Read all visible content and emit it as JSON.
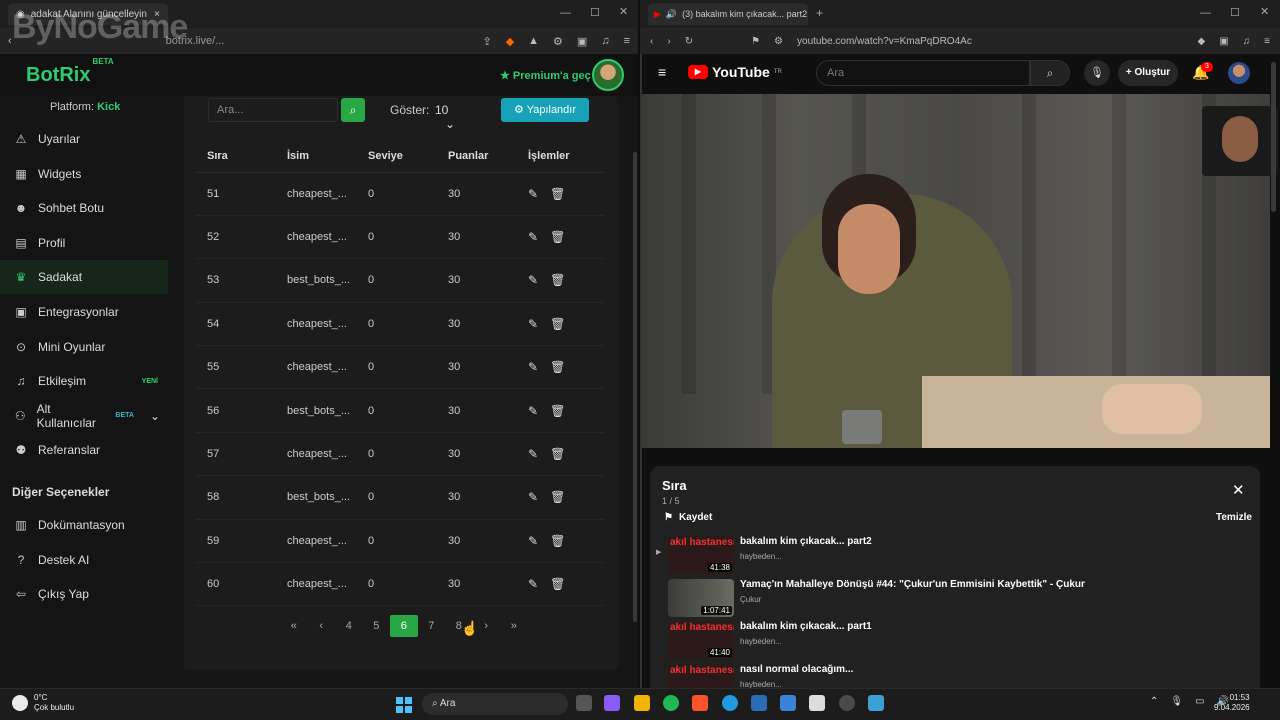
{
  "left_browser": {
    "tab_title": "adakat Alanını güncelleyin",
    "address_url": "botrix.live/...",
    "watermark": "ByNoGame"
  },
  "app": {
    "logo": "BotRix",
    "logo_badge": "BETA",
    "premium_label": "Premium'a geç",
    "platform_label": "Platform:",
    "platform_value": "Kick"
  },
  "sidebar": {
    "items": [
      {
        "label": "Uyarılar",
        "icon": "warning-icon"
      },
      {
        "label": "Widgets",
        "icon": "grid-icon"
      },
      {
        "label": "Sohbet Botu",
        "icon": "robot-icon"
      },
      {
        "label": "Profil",
        "icon": "id-card-icon"
      },
      {
        "label": "Sadakat",
        "icon": "trophy-icon"
      },
      {
        "label": "Entegrasyonlar",
        "icon": "plug-icon"
      },
      {
        "label": "Mini Oyunlar",
        "icon": "gamepad-icon"
      },
      {
        "label": "Etkileşim",
        "icon": "music-icon",
        "badge": "YENİ"
      },
      {
        "label": "Alt Kullanıcılar",
        "icon": "users-icon",
        "badge": "BETA"
      },
      {
        "label": "Referanslar",
        "icon": "user-friends-icon"
      }
    ],
    "section_title": "Diğer Seçenekler",
    "extra_items": [
      {
        "label": "Dokümantasyon",
        "icon": "book-icon"
      },
      {
        "label": "Destek AI",
        "icon": "question-icon"
      },
      {
        "label": "Çıkış Yap",
        "icon": "logout-icon"
      }
    ]
  },
  "toolbar": {
    "search_placeholder": "Ara...",
    "show_label": "Göster:",
    "show_value": "10",
    "configure_label": "Yapılandır"
  },
  "table": {
    "headers": [
      "Sıra",
      "İsim",
      "Seviye",
      "Puanlar",
      "İşlemler"
    ],
    "rows": [
      [
        "51",
        "cheapest_...",
        "0",
        "30"
      ],
      [
        "52",
        "cheapest_...",
        "0",
        "30"
      ],
      [
        "53",
        "best_bots_...",
        "0",
        "30"
      ],
      [
        "54",
        "cheapest_...",
        "0",
        "30"
      ],
      [
        "55",
        "cheapest_...",
        "0",
        "30"
      ],
      [
        "56",
        "best_bots_...",
        "0",
        "30"
      ],
      [
        "57",
        "cheapest_...",
        "0",
        "30"
      ],
      [
        "58",
        "best_bots_...",
        "0",
        "30"
      ],
      [
        "59",
        "cheapest_...",
        "0",
        "30"
      ],
      [
        "60",
        "cheapest_...",
        "0",
        "30"
      ]
    ]
  },
  "pagination": {
    "first": "«",
    "prev": "‹",
    "pages": [
      "4",
      "5",
      "6",
      "7",
      "8"
    ],
    "current": "6",
    "next": "›",
    "last": "»"
  },
  "right_browser": {
    "tab_title": "(3) bakalım kim çıkacak... part2",
    "address_url": "youtube.com/watch?v=KmaPqDRO4Ac"
  },
  "youtube": {
    "logo": "YouTube",
    "region": "TR",
    "search_placeholder": "Ara",
    "create_label": "Oluştur",
    "notifications": "3",
    "queue": {
      "title": "Sıra",
      "count": "1 / 5",
      "save_label": "Kaydet",
      "clear_label": "Temizle",
      "items": [
        {
          "title": "bakalım kim çıkacak... part2",
          "channel": "haybeden...",
          "duration": "41:38",
          "thumb_text": "akıl hastanesi"
        },
        {
          "title": "Yamaç'ın Mahalleye Dönüşü #44: \"Çukur'un Emmisini Kaybettik\" - Çukur",
          "channel": "Çukur",
          "duration": "1:07:41",
          "thumb_text": ""
        },
        {
          "title": "bakalım kim çıkacak... part1",
          "channel": "haybeden...",
          "duration": "41:40",
          "thumb_text": "akıl hastanesi"
        },
        {
          "title": "nasıl normal olacağım...",
          "channel": "haybeden...",
          "duration": "",
          "thumb_text": "akıl hastanesi"
        }
      ]
    }
  },
  "taskbar": {
    "temperature": "0°C",
    "weather": "Çok bulutlu",
    "search": "Ara",
    "time": "01:53",
    "date": "9.04.2026"
  },
  "colors": {
    "accent": "#28a745",
    "configure": "#17a2b8",
    "youtube_red": "#ff0000"
  }
}
